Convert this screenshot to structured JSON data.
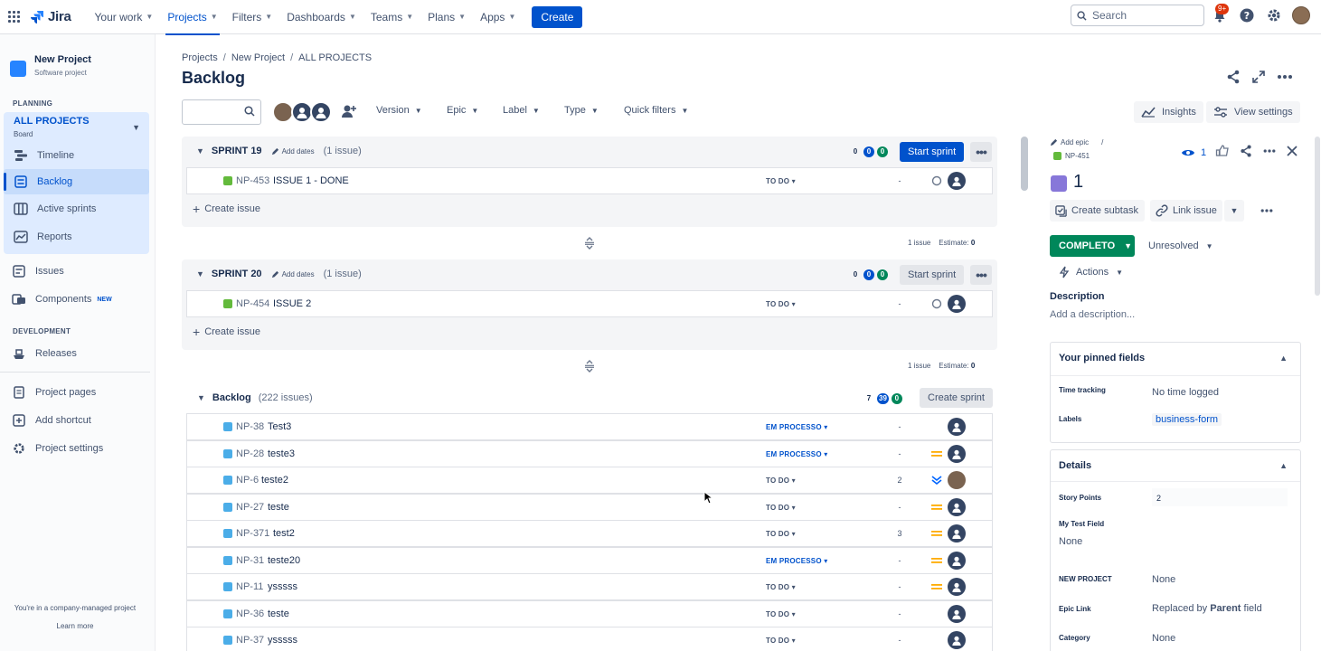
{
  "topnav": {
    "product": "Jira",
    "items": [
      {
        "label": "Your work"
      },
      {
        "label": "Projects"
      },
      {
        "label": "Filters"
      },
      {
        "label": "Dashboards"
      },
      {
        "label": "Teams"
      },
      {
        "label": "Plans"
      },
      {
        "label": "Apps"
      }
    ],
    "create_label": "Create",
    "search_placeholder": "Search",
    "notifications_badge": "9+"
  },
  "sidebar": {
    "project_name": "New Project",
    "project_type": "Software project",
    "planning_heading": "PLANNING",
    "board_name": "ALL PROJECTS",
    "board_type": "Board",
    "planning_items": [
      {
        "label": "Timeline"
      },
      {
        "label": "Backlog"
      },
      {
        "label": "Active sprints"
      },
      {
        "label": "Reports"
      }
    ],
    "issues_label": "Issues",
    "components_label": "Components",
    "new_badge": "NEW",
    "development_heading": "DEVELOPMENT",
    "releases_label": "Releases",
    "project_pages_label": "Project pages",
    "add_shortcut_label": "Add shortcut",
    "project_settings_label": "Project settings",
    "footer_text": "You're in a company-managed project",
    "learn_more": "Learn more"
  },
  "breadcrumbs": [
    "Projects",
    "New Project",
    "ALL PROJECTS"
  ],
  "page_title": "Backlog",
  "filters": {
    "version": "Version",
    "epic": "Epic",
    "label": "Label",
    "type": "Type",
    "quick_filters": "Quick filters",
    "insights": "Insights",
    "view_settings": "View settings"
  },
  "sprints": [
    {
      "name": "SPRINT 19",
      "add_dates": "Add dates",
      "count_label": "(1 issue)",
      "counts": [
        "0",
        "0",
        "0"
      ],
      "button": "Start sprint",
      "issues": [
        {
          "key": "NP-453",
          "summary": "ISSUE 1 - DONE",
          "status": "TO DO",
          "estimate": "-"
        }
      ],
      "create_issue": "Create issue",
      "summary_issues": "1 issue",
      "summary_estimate_label": "Estimate:",
      "summary_estimate_value": "0"
    },
    {
      "name": "SPRINT 20",
      "add_dates": "Add dates",
      "count_label": "(1 issue)",
      "counts": [
        "0",
        "0",
        "0"
      ],
      "button": "Start sprint",
      "issues": [
        {
          "key": "NP-454",
          "summary": "ISSUE 2",
          "status": "TO DO",
          "estimate": "-"
        }
      ],
      "create_issue": "Create issue",
      "summary_issues": "1 issue",
      "summary_estimate_label": "Estimate:",
      "summary_estimate_value": "0"
    }
  ],
  "backlog": {
    "name": "Backlog",
    "count_label": "(222 issues)",
    "counts": [
      "7",
      "39",
      "0"
    ],
    "button": "Create sprint",
    "issues": [
      {
        "key": "NP-38",
        "summary": "Test3",
        "status": "EM PROCESSO",
        "estimate": "-",
        "priority": "none"
      },
      {
        "key": "NP-28",
        "summary": "teste3",
        "status": "EM PROCESSO",
        "estimate": "-",
        "priority": "medium"
      },
      {
        "key": "NP-6",
        "summary": "teste2",
        "status": "TO DO",
        "estimate": "2",
        "priority": "lowest"
      },
      {
        "key": "NP-27",
        "summary": "teste",
        "status": "TO DO",
        "estimate": "-",
        "priority": "medium"
      },
      {
        "key": "NP-371",
        "summary": "test2",
        "status": "TO DO",
        "estimate": "3",
        "priority": "medium"
      },
      {
        "key": "NP-31",
        "summary": "teste20",
        "status": "EM PROCESSO",
        "estimate": "-",
        "priority": "medium"
      },
      {
        "key": "NP-11",
        "summary": "ysssss",
        "status": "TO DO",
        "estimate": "-",
        "priority": "medium"
      },
      {
        "key": "NP-36",
        "summary": "teste",
        "status": "TO DO",
        "estimate": "-",
        "priority": "none"
      },
      {
        "key": "NP-37",
        "summary": "ysssss",
        "status": "TO DO",
        "estimate": "-",
        "priority": "none"
      }
    ]
  },
  "detail": {
    "add_epic": "Add epic",
    "issue_key": "NP-451",
    "watch_count": "1",
    "title": "1",
    "create_subtask": "Create subtask",
    "link_issue": "Link issue",
    "status": "COMPLETO",
    "resolution": "Unresolved",
    "actions": "Actions",
    "description_label": "Description",
    "description_placeholder": "Add a description...",
    "pinned_heading": "Your pinned fields",
    "time_tracking_label": "Time tracking",
    "time_tracking_value": "No time logged",
    "labels_label": "Labels",
    "labels_value": "business-form",
    "details_heading": "Details",
    "story_points_label": "Story Points",
    "story_points_value": "2",
    "my_test_field_label": "My Test Field",
    "my_test_field_value": "None",
    "new_project_label": "NEW PROJECT",
    "new_project_value": "None",
    "epic_link_label": "Epic Link",
    "epic_link_prefix": "Replaced by",
    "epic_link_strong": "Parent",
    "epic_link_suffix": "field",
    "category_label": "Category",
    "category_value": "None"
  },
  "colors": {
    "brand": "#0052cc",
    "done_green": "#00875a",
    "story_green": "#63ba3c",
    "task_blue": "#4bade8",
    "epic_purple": "#8777d9"
  }
}
